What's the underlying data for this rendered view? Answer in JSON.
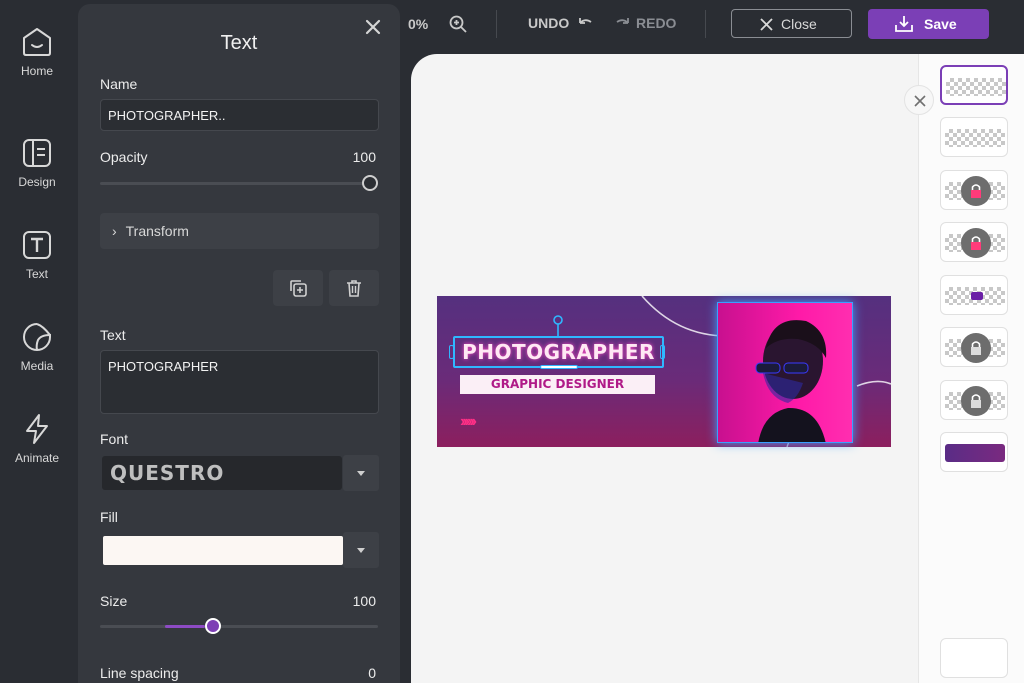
{
  "rail": {
    "items": [
      {
        "label": "Home",
        "icon": "home-icon"
      },
      {
        "label": "Design",
        "icon": "design-icon"
      },
      {
        "label": "Text",
        "icon": "text-icon"
      },
      {
        "label": "Media",
        "icon": "media-icon"
      },
      {
        "label": "Animate",
        "icon": "animate-icon"
      }
    ]
  },
  "panel": {
    "title": "Text",
    "name_label": "Name",
    "name_value": "PHOTOGRAPHER..",
    "opacity_label": "Opacity",
    "opacity_value": "100",
    "opacity_fraction": 1.0,
    "transform_label": "Transform",
    "text_label": "Text",
    "text_value": "PHOTOGRAPHER",
    "font_label": "Font",
    "font_value": "QUESTRO",
    "fill_label": "Fill",
    "fill_color": "#fcf7f3",
    "size_label": "Size",
    "size_value": "100",
    "line_spacing_label": "Line spacing",
    "line_spacing_value": "0"
  },
  "topbar": {
    "zoom_text": "0%",
    "undo_label": "UNDO",
    "redo_label": "REDO",
    "close_label": "Close",
    "save_label": "Save"
  },
  "banner": {
    "title": "PHOTOGRAPHER",
    "subtitle": "GRAPHIC DESIGNER",
    "chevrons": "››››››"
  },
  "colors": {
    "accent": "#7b3fb6",
    "panel_bg": "#35383e",
    "app_bg": "#2a2d33",
    "canvas_bg": "#f4f4f4"
  }
}
